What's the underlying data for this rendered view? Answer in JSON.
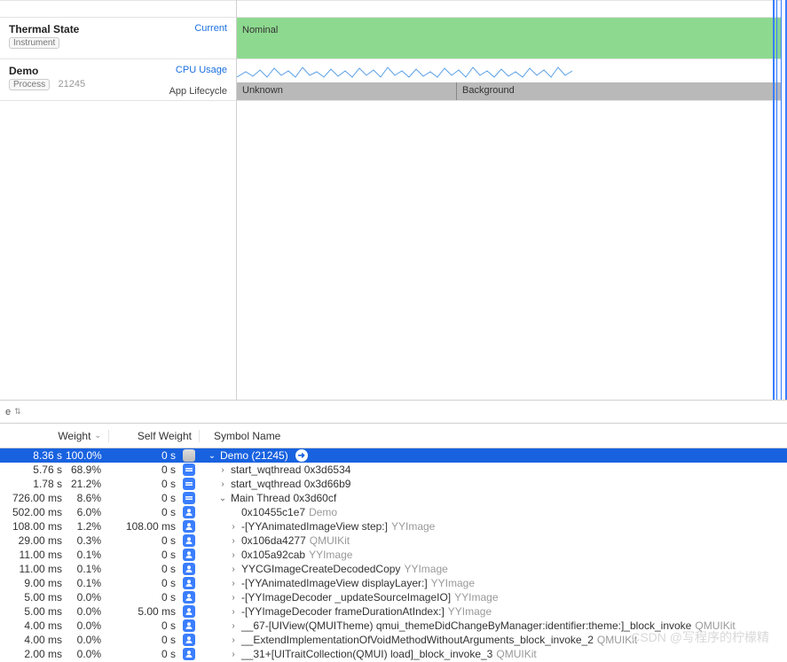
{
  "tracks": {
    "thermal": {
      "title": "Thermal State",
      "badge": "Instrument",
      "right": "Current",
      "lane_label": "Nominal"
    },
    "demo": {
      "title": "Demo",
      "badge": "Process",
      "pid": "21245",
      "right_top": "CPU Usage",
      "right_bottom": "App Lifecycle",
      "unknown": "Unknown",
      "background": "Background"
    }
  },
  "filter": {
    "label": "e"
  },
  "headers": {
    "weight": "Weight",
    "self": "Self Weight",
    "symbol": "Symbol Name"
  },
  "rows": [
    {
      "w": "8.36 s",
      "p": "100.0%",
      "s": "0 s",
      "icon": "app",
      "depth": 0,
      "disc": "down",
      "sym": "Demo (21245)",
      "lib": "",
      "go": true,
      "sel": true
    },
    {
      "w": "5.76 s",
      "p": "68.9%",
      "s": "0 s",
      "icon": "thr",
      "depth": 1,
      "disc": "right",
      "sym": "start_wqthread",
      "addr": "0x3d6534",
      "lib": ""
    },
    {
      "w": "1.78 s",
      "p": "21.2%",
      "s": "0 s",
      "icon": "thr",
      "depth": 1,
      "disc": "right",
      "sym": "start_wqthread",
      "addr": "0x3d66b9",
      "lib": ""
    },
    {
      "w": "726.00 ms",
      "p": "8.6%",
      "s": "0 s",
      "icon": "thr",
      "depth": 1,
      "disc": "down",
      "sym": "Main Thread",
      "addr": "0x3d60cf",
      "lib": ""
    },
    {
      "w": "502.00 ms",
      "p": "6.0%",
      "s": "0 s",
      "icon": "usr",
      "depth": 2,
      "disc": "",
      "sym": "0x10455c1e7",
      "lib": "Demo"
    },
    {
      "w": "108.00 ms",
      "p": "1.2%",
      "s": "108.00 ms",
      "icon": "usr",
      "depth": 2,
      "disc": "right",
      "sym": "-[YYAnimatedImageView step:]",
      "lib": "YYImage"
    },
    {
      "w": "29.00 ms",
      "p": "0.3%",
      "s": "0 s",
      "icon": "usr",
      "depth": 2,
      "disc": "right",
      "sym": "0x106da4277",
      "lib": "QMUIKit"
    },
    {
      "w": "11.00 ms",
      "p": "0.1%",
      "s": "0 s",
      "icon": "usr",
      "depth": 2,
      "disc": "right",
      "sym": "0x105a92cab",
      "lib": "YYImage"
    },
    {
      "w": "11.00 ms",
      "p": "0.1%",
      "s": "0 s",
      "icon": "usr",
      "depth": 2,
      "disc": "right",
      "sym": "YYCGImageCreateDecodedCopy",
      "lib": "YYImage"
    },
    {
      "w": "9.00 ms",
      "p": "0.1%",
      "s": "0 s",
      "icon": "usr",
      "depth": 2,
      "disc": "right",
      "sym": "-[YYAnimatedImageView displayLayer:]",
      "lib": "YYImage"
    },
    {
      "w": "5.00 ms",
      "p": "0.0%",
      "s": "0 s",
      "icon": "usr",
      "depth": 2,
      "disc": "right",
      "sym": "-[YYImageDecoder _updateSourceImageIO]",
      "lib": "YYImage"
    },
    {
      "w": "5.00 ms",
      "p": "0.0%",
      "s": "5.00 ms",
      "icon": "usr",
      "depth": 2,
      "disc": "right",
      "sym": "-[YYImageDecoder frameDurationAtIndex:]",
      "lib": "YYImage"
    },
    {
      "w": "4.00 ms",
      "p": "0.0%",
      "s": "0 s",
      "icon": "usr",
      "depth": 2,
      "disc": "right",
      "sym": "__67-[UIView(QMUITheme) qmui_themeDidChangeByManager:identifier:theme:]_block_invoke",
      "lib": "QMUIKit"
    },
    {
      "w": "4.00 ms",
      "p": "0.0%",
      "s": "0 s",
      "icon": "usr",
      "depth": 2,
      "disc": "right",
      "sym": "__ExtendImplementationOfVoidMethodWithoutArguments_block_invoke_2",
      "lib": "QMUIKit"
    },
    {
      "w": "2.00 ms",
      "p": "0.0%",
      "s": "0 s",
      "icon": "usr",
      "depth": 2,
      "disc": "right",
      "sym": "__31+[UITraitCollection(QMUI) load]_block_invoke_3",
      "lib": "QMUIKit"
    }
  ],
  "watermark": "CSDN @写程序的柠檬精"
}
